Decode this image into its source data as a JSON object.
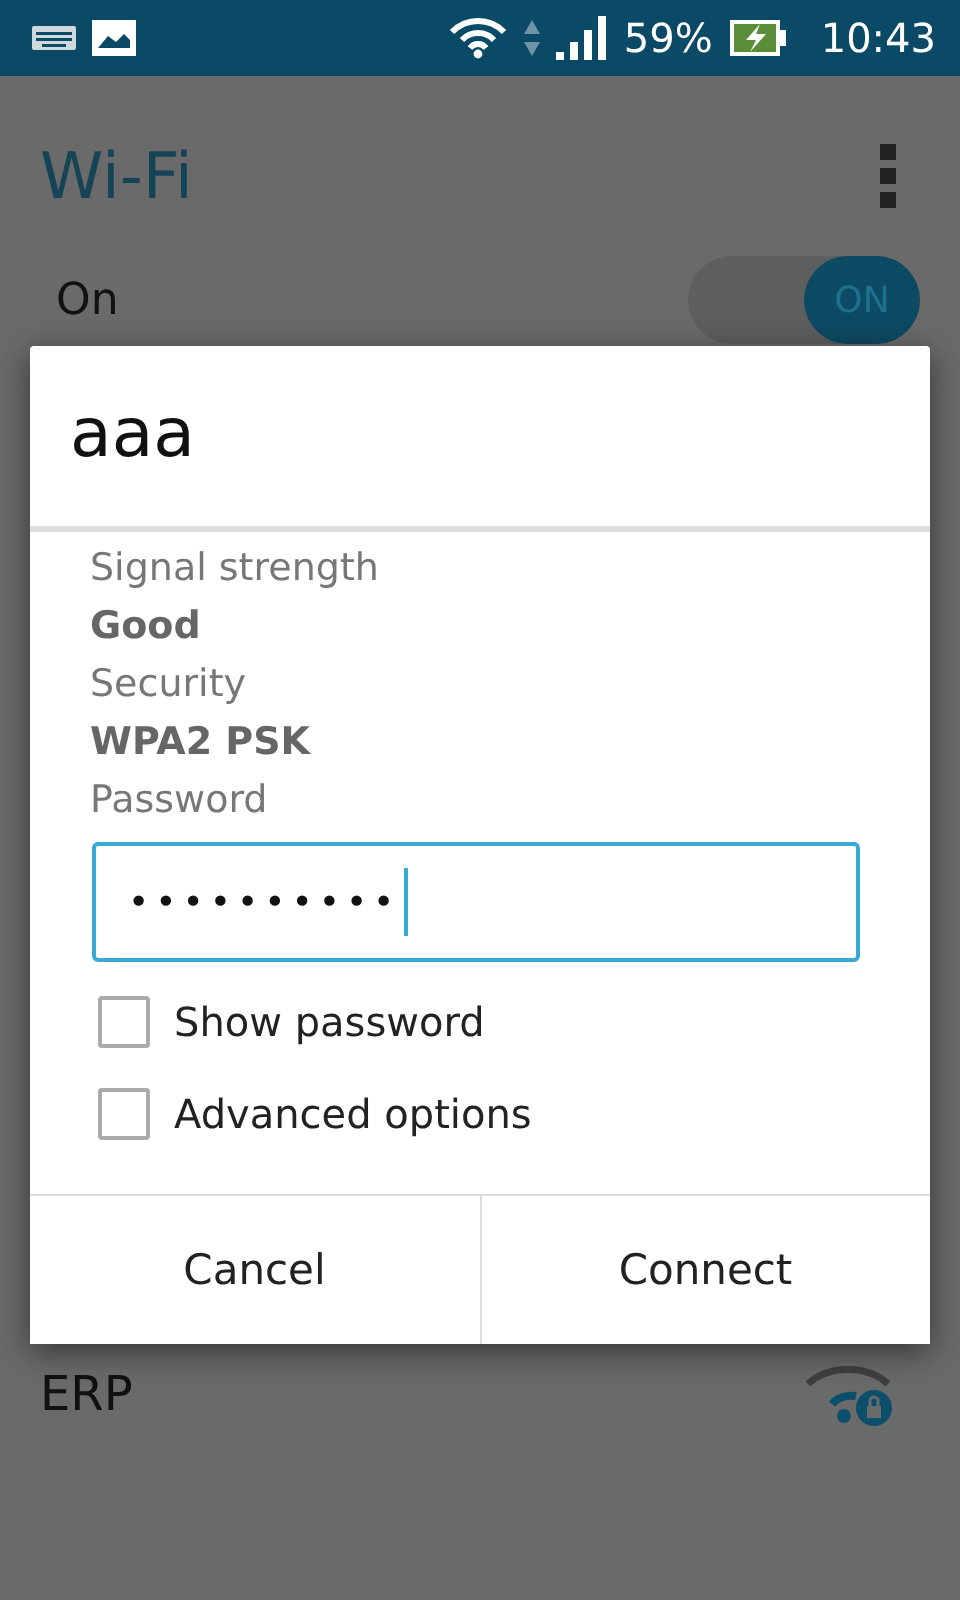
{
  "status_bar": {
    "battery_text": "59%",
    "time": "10:43"
  },
  "header": {
    "title": "Wi-Fi"
  },
  "wifi_toggle": {
    "label": "On",
    "switch_text": "ON",
    "on": true
  },
  "networks": [
    {
      "name": "ERP",
      "locked": true
    }
  ],
  "dialog": {
    "title": "aaa",
    "details": [
      {
        "label": "Signal strength",
        "value": "Good"
      },
      {
        "label": "Security",
        "value": "WPA2 PSK"
      }
    ],
    "password_label": "Password",
    "password_value": "••••••••••",
    "options": [
      {
        "label": "Show password",
        "checked": false
      },
      {
        "label": "Advanced options",
        "checked": false
      }
    ],
    "buttons": [
      "Cancel",
      "Connect"
    ]
  }
}
